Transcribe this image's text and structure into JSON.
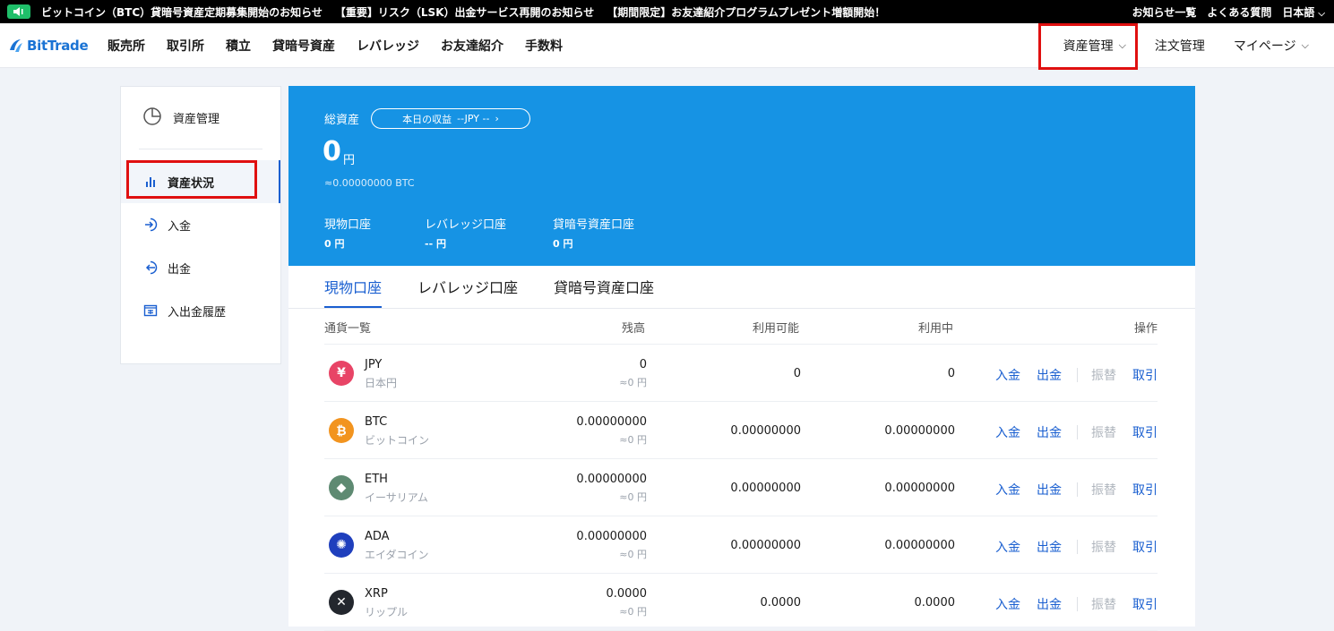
{
  "announcement": {
    "items": [
      "ビットコイン（BTC）貸暗号資産定期募集開始のお知らせ",
      "【重要】リスク（LSK）出金サービス再開のお知らせ",
      "【期間限定】お友達紹介プログラムプレゼント増額開始！"
    ],
    "links": [
      "お知らせ一覧",
      "よくある質問",
      "日本語"
    ]
  },
  "header": {
    "logo": "BitTrade",
    "nav": [
      "販売所",
      "取引所",
      "積立",
      "貸暗号資産",
      "レバレッジ",
      "お友達紹介",
      "手数料"
    ],
    "right": [
      "資産管理",
      "注文管理",
      "マイページ"
    ]
  },
  "sidebar": {
    "title": "資産管理",
    "items": [
      "資産状況",
      "入金",
      "出金",
      "入出金履歴"
    ]
  },
  "hero": {
    "total_label": "総資産",
    "today_pill": "本日の収益",
    "today_value": "--JPY --",
    "total_value": "0",
    "total_unit": "円",
    "btc_equiv": "≈0.00000000 BTC",
    "accounts": [
      {
        "label": "現物口座",
        "value": "0 円"
      },
      {
        "label": "レバレッジ口座",
        "value": "-- 円"
      },
      {
        "label": "貸暗号資産口座",
        "value": "0 円"
      }
    ]
  },
  "tabs": [
    "現物口座",
    "レバレッジ口座",
    "貸暗号資産口座"
  ],
  "table": {
    "headers": [
      "通貨一覧",
      "残高",
      "利用可能",
      "利用中",
      "操作"
    ],
    "actions": [
      "入金",
      "出金",
      "振替",
      "取引"
    ],
    "rows": [
      {
        "code": "JPY",
        "name": "日本円",
        "balance": "0",
        "balance_jpy": "≈0 円",
        "available": "0",
        "in_use": "0",
        "color": "#e84466",
        "glyph": "¥"
      },
      {
        "code": "BTC",
        "name": "ビットコイン",
        "balance": "0.00000000",
        "balance_jpy": "≈0 円",
        "available": "0.00000000",
        "in_use": "0.00000000",
        "color": "#f2941f",
        "glyph": "₿"
      },
      {
        "code": "ETH",
        "name": "イーサリアム",
        "balance": "0.00000000",
        "balance_jpy": "≈0 円",
        "available": "0.00000000",
        "in_use": "0.00000000",
        "color": "#5e8a72",
        "glyph": "◆"
      },
      {
        "code": "ADA",
        "name": "エイダコイン",
        "balance": "0.00000000",
        "balance_jpy": "≈0 円",
        "available": "0.00000000",
        "in_use": "0.00000000",
        "color": "#1f3fbd",
        "glyph": "✺"
      },
      {
        "code": "XRP",
        "name": "リップル",
        "balance": "0.0000",
        "balance_jpy": "≈0 円",
        "available": "0.0000",
        "in_use": "0.0000",
        "color": "#23272e",
        "glyph": "✕"
      }
    ]
  }
}
